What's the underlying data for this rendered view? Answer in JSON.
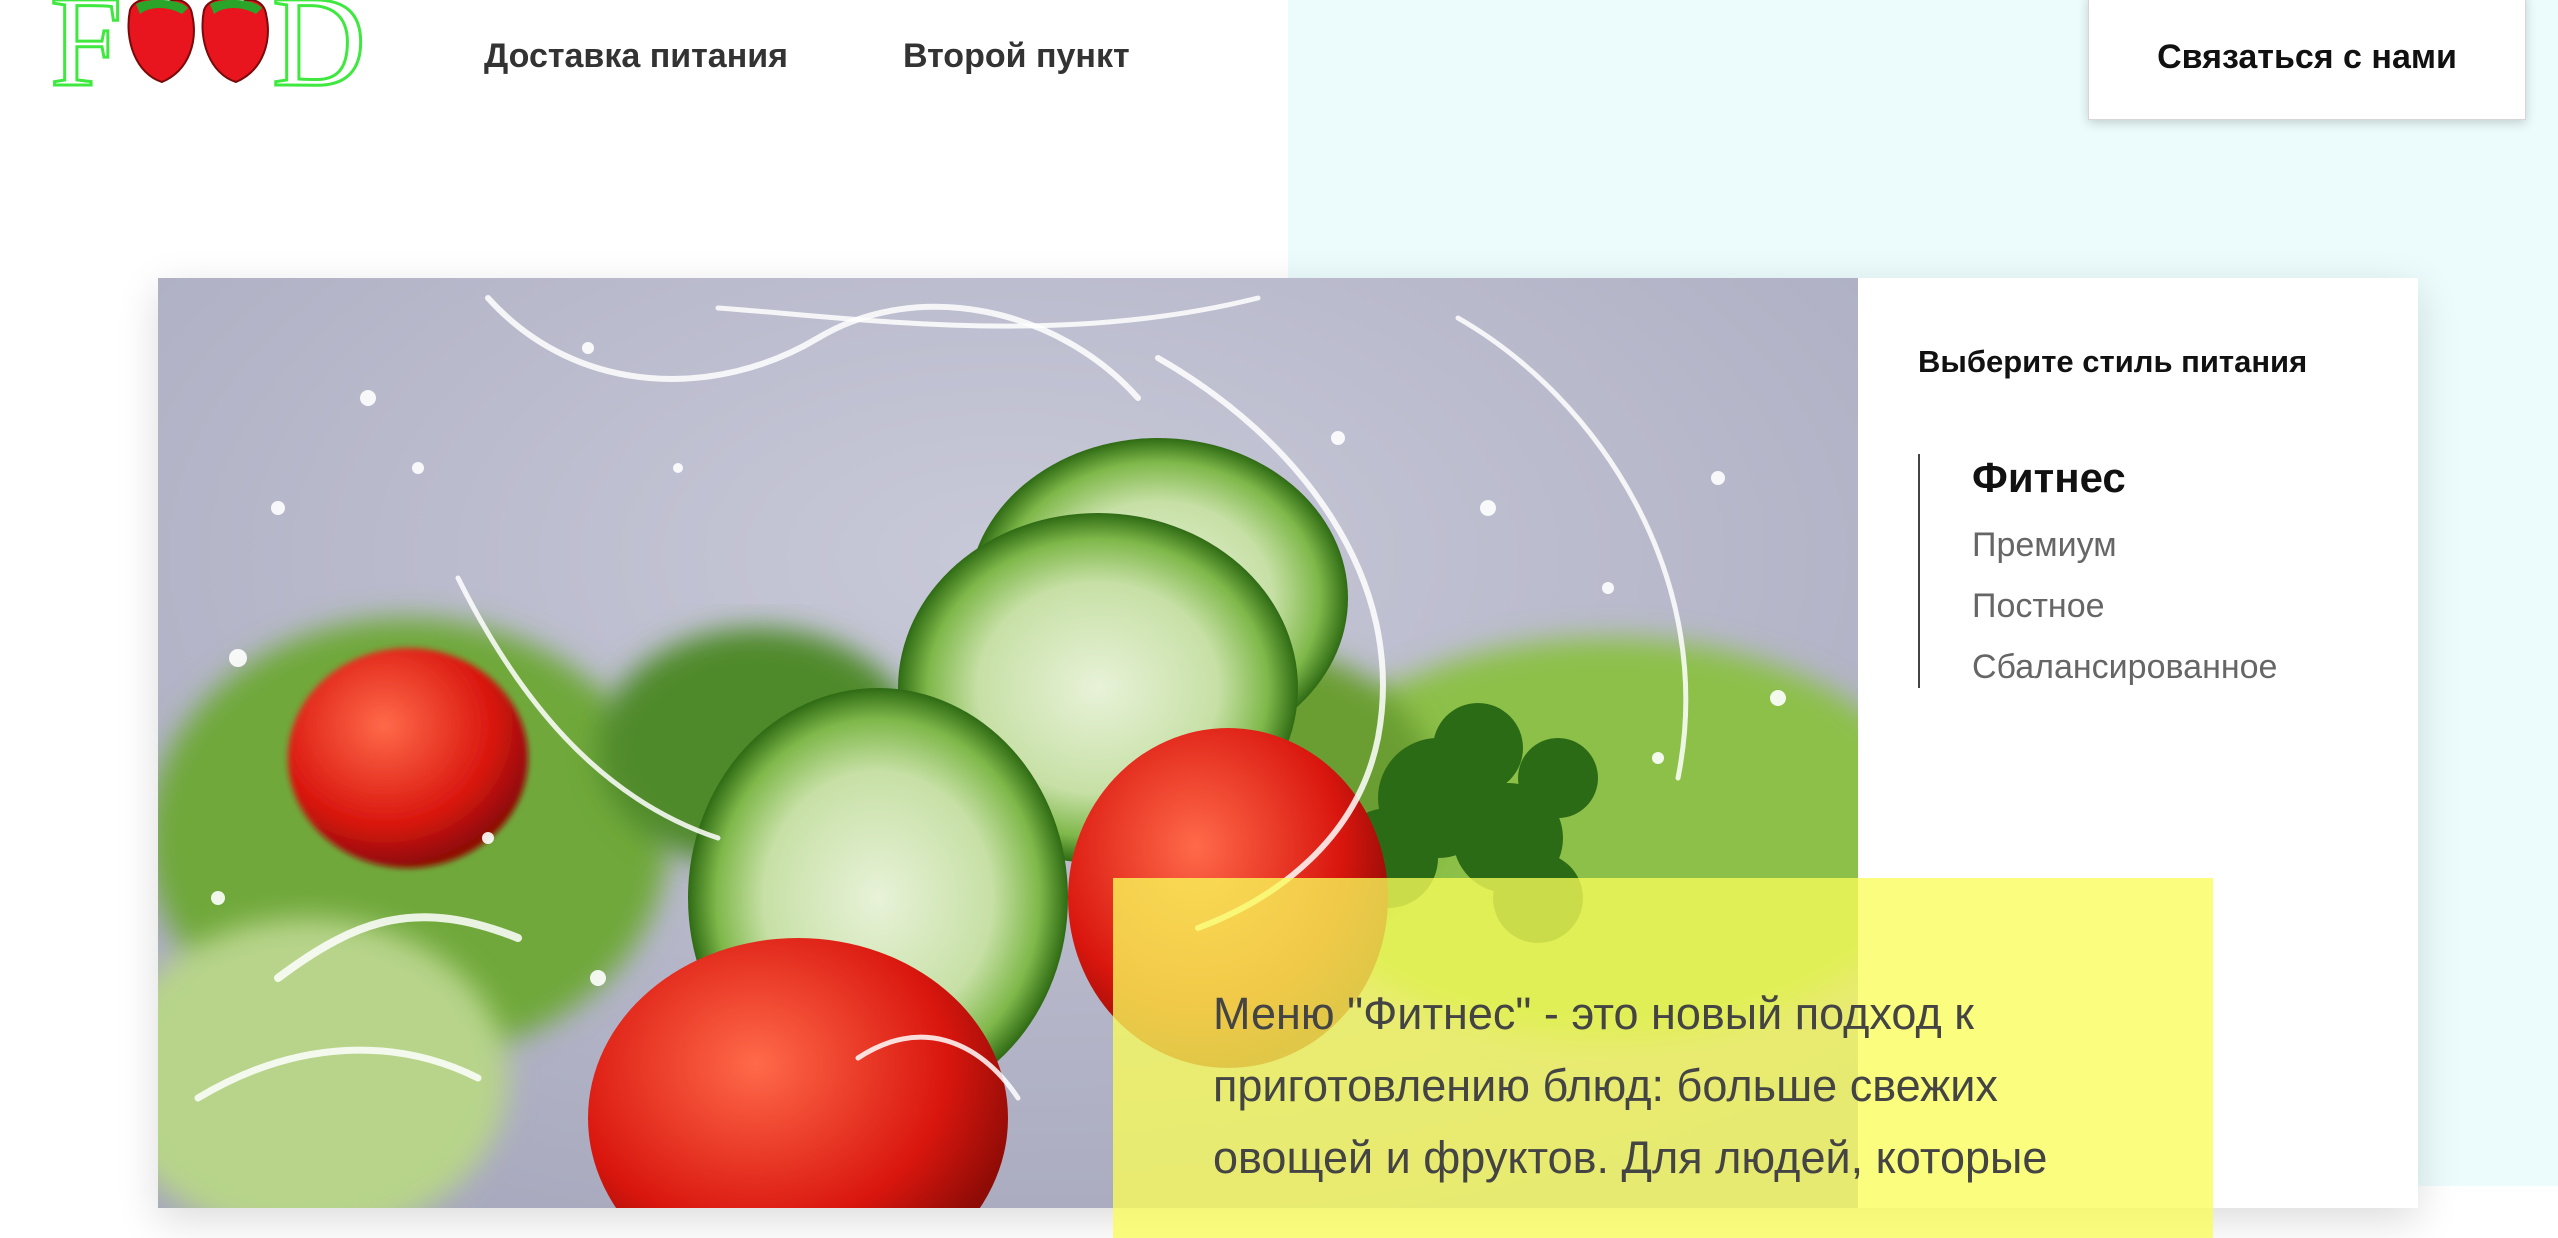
{
  "header": {
    "logo_letters": {
      "first": "F",
      "last": "D"
    },
    "nav": [
      {
        "label": "Доставка питания"
      },
      {
        "label": "Второй пункт"
      }
    ],
    "contact_label": "Связаться с нами"
  },
  "panel": {
    "title": "Выберите стиль питания",
    "menu": [
      {
        "label": "Фитнес",
        "active": true
      },
      {
        "label": "Премиум",
        "active": false
      },
      {
        "label": "Постное",
        "active": false
      },
      {
        "label": "Сбалансированное",
        "active": false
      }
    ],
    "description": "Меню \"Фитнес\" - это новый подход к приготовлению блюд: больше свежих овощей и фруктов. Для людей, которые"
  },
  "colors": {
    "logo_green": "#3ee83e",
    "pepper_red": "#e8141e",
    "accent_yellow": "#f8fc5a",
    "right_bg": "#ecfcfc"
  }
}
